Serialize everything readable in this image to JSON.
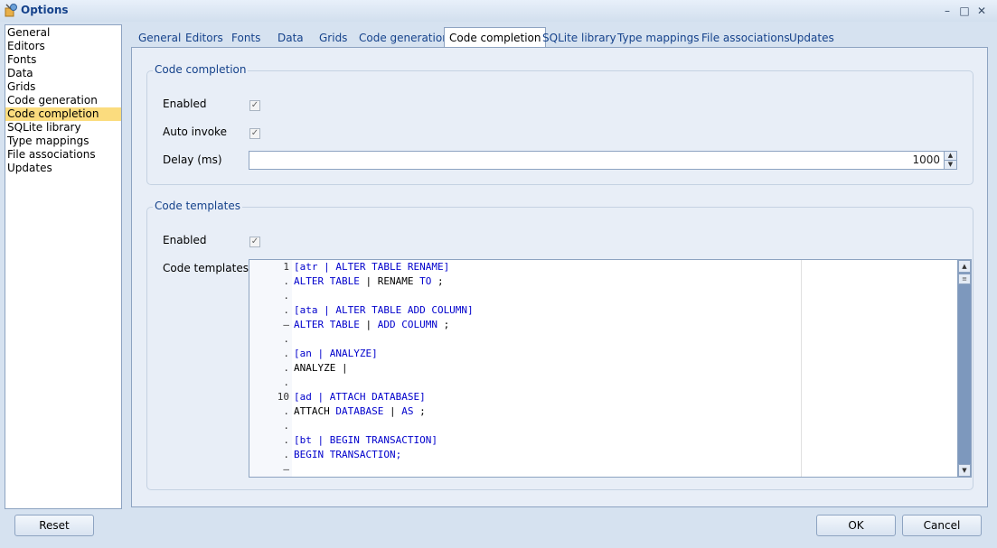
{
  "window": {
    "title": "Options",
    "app_icon": "options-icon",
    "controls": {
      "minimize": "–",
      "maximize": "□",
      "close": "✕"
    }
  },
  "categories": [
    "General",
    "Editors",
    "Fonts",
    "Data",
    "Grids",
    "Code generation",
    "Code completion",
    "SQLite library",
    "Type mappings",
    "File associations",
    "Updates"
  ],
  "selected_category": "Code completion",
  "tabs": [
    "General",
    "Editors",
    "Fonts",
    "Data",
    "Grids",
    "Code generation",
    "Code completion",
    "SQLite library",
    "Type mappings",
    "File associations",
    "Updates"
  ],
  "active_tab": "Code completion",
  "code_completion": {
    "group_title": "Code completion",
    "enabled_label": "Enabled",
    "enabled_checked": true,
    "auto_invoke_label": "Auto invoke",
    "auto_invoke_checked": true,
    "delay_label": "Delay (ms)",
    "delay_value": "1000"
  },
  "code_templates": {
    "group_title": "Code templates",
    "enabled_label": "Enabled",
    "enabled_checked": true,
    "editor_label": "Code templates",
    "gutter": [
      "1",
      ".",
      ".",
      ".",
      "–",
      ".",
      ".",
      ".",
      ".",
      "10",
      ".",
      ".",
      ".",
      ".",
      "–"
    ],
    "lines": [
      [
        {
          "t": "[atr | ALTER TABLE RENAME]",
          "c": "kw"
        }
      ],
      [
        {
          "t": "ALTER TABLE",
          "c": "kw"
        },
        {
          "t": " | RENAME ",
          "c": ""
        },
        {
          "t": "TO",
          "c": "kw"
        },
        {
          "t": " ;",
          "c": ""
        }
      ],
      [],
      [
        {
          "t": "[ata | ALTER TABLE ADD COLUMN]",
          "c": "kw"
        }
      ],
      [
        {
          "t": "ALTER TABLE",
          "c": "kw"
        },
        {
          "t": " | ",
          "c": ""
        },
        {
          "t": "ADD COLUMN",
          "c": "kw"
        },
        {
          "t": " ;",
          "c": ""
        }
      ],
      [],
      [
        {
          "t": "[an | ANALYZE]",
          "c": "kw"
        }
      ],
      [
        {
          "t": "ANALYZE |",
          "c": ""
        }
      ],
      [],
      [
        {
          "t": "[ad | ATTACH DATABASE]",
          "c": "kw"
        }
      ],
      [
        {
          "t": "ATTACH ",
          "c": ""
        },
        {
          "t": "DATABASE",
          "c": "kw"
        },
        {
          "t": " | ",
          "c": ""
        },
        {
          "t": "AS",
          "c": "kw"
        },
        {
          "t": " ;",
          "c": ""
        }
      ],
      [],
      [
        {
          "t": "[bt | BEGIN TRANSACTION]",
          "c": "kw"
        }
      ],
      [
        {
          "t": "BEGIN TRANSACTION;",
          "c": "kw"
        }
      ],
      []
    ]
  },
  "buttons": {
    "reset": "Reset",
    "ok": "OK",
    "cancel": "Cancel"
  }
}
